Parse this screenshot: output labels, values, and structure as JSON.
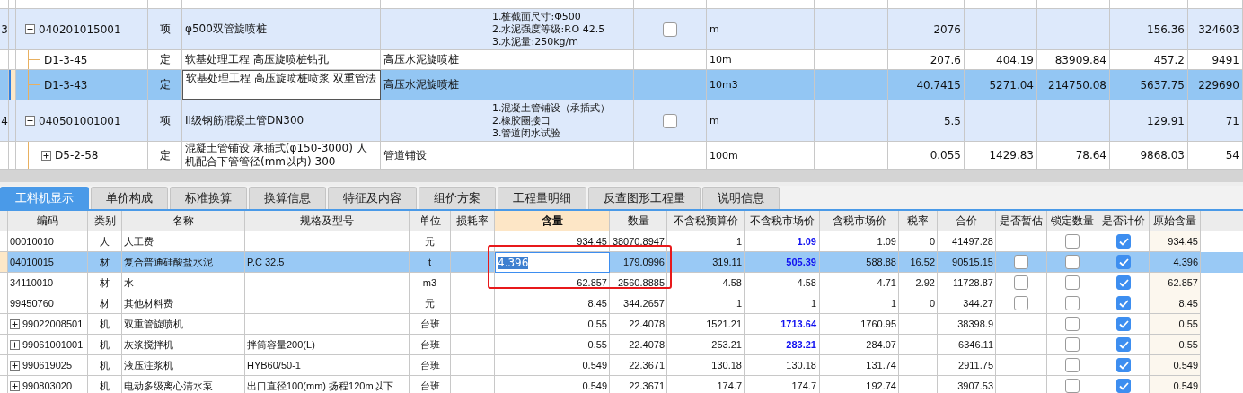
{
  "upper_grid": {
    "rows": [
      {
        "number": "3",
        "code": "040201015001",
        "type": "项",
        "kind": "item",
        "selected": false,
        "expanded": true,
        "name": "φ500双管旋喷桩",
        "features": [
          "1.桩截面尺寸:Φ500",
          "2.水泥强度等级:P.O 42.5",
          "3.水泥量:250kg/m"
        ],
        "checked": false,
        "unit": "m",
        "column_10": "2076",
        "column_13": "156.36",
        "column_14": "324603",
        "children": [
          {
            "code": "D1-3-45",
            "type": "定",
            "kind": "quota",
            "selected": false,
            "name": "软基处理工程 高压旋喷桩钻孔",
            "column_6": "高压水泥旋喷桩",
            "unit": "10m",
            "column_10": "207.6",
            "column_11": "404.19",
            "column_12": "83909.84",
            "column_13": "457.2",
            "column_14": "9491"
          },
          {
            "code": "D1-3-43",
            "type": "定",
            "kind": "quota",
            "selected": true,
            "name": "软基处理工程 高压旋喷桩喷浆 双重管法",
            "column_6": "高压水泥旋喷桩",
            "unit": "10m3",
            "column_10": "40.7415",
            "column_11": "5271.04",
            "column_12": "214750.08",
            "column_13": "5637.75",
            "column_14": "229690"
          }
        ]
      },
      {
        "number": "4",
        "code": "040501001001",
        "type": "项",
        "kind": "item",
        "selected": false,
        "expanded": true,
        "name": "II级钢筋混凝土管DN300",
        "features": [
          "1.混凝土管铺设（承插式）",
          "2.橡胶圈接口",
          "3.管道闭水试验"
        ],
        "checked": false,
        "unit": "m",
        "column_10": "5.5",
        "column_13": "129.91",
        "column_14": "71",
        "children": [
          {
            "code": "D5-2-58",
            "type": "定",
            "kind": "quota",
            "selected": false,
            "expanded": false,
            "name": "混凝土管铺设 承插式(φ150-3000) 人机配合下管管径(mm以内) 300",
            "column_6": "管道铺设",
            "unit": "100m",
            "column_10": "0.055",
            "column_11": "1429.83",
            "column_12": "78.64",
            "column_13": "9868.03",
            "column_14": "54"
          }
        ]
      }
    ]
  },
  "tabs": [
    {
      "label": "工料机显示",
      "selected": true
    },
    {
      "label": "单价构成",
      "selected": false
    },
    {
      "label": "标准换算",
      "selected": false
    },
    {
      "label": "换算信息",
      "selected": false
    },
    {
      "label": "特征及内容",
      "selected": false
    },
    {
      "label": "组价方案",
      "selected": false
    },
    {
      "label": "工程量明细",
      "selected": false
    },
    {
      "label": "反查图形工程量",
      "selected": false
    },
    {
      "label": "说明信息",
      "selected": false
    }
  ],
  "resource_table": {
    "columns": [
      {
        "label": "编码",
        "selected": false
      },
      {
        "label": "类别",
        "selected": false
      },
      {
        "label": "名称",
        "selected": false
      },
      {
        "label": "规格及型号",
        "selected": false
      },
      {
        "label": "单位",
        "selected": false
      },
      {
        "label": "损耗率",
        "selected": false
      },
      {
        "label": "含量",
        "selected": true
      },
      {
        "label": "数量",
        "selected": false
      },
      {
        "label": "不含税预算价",
        "selected": false
      },
      {
        "label": "不含税市场价",
        "selected": false
      },
      {
        "label": "含税市场价",
        "selected": false
      },
      {
        "label": "税率",
        "selected": false
      },
      {
        "label": "合价",
        "selected": false
      },
      {
        "label": "是否暂估",
        "selected": false
      },
      {
        "label": "锁定数量",
        "selected": false
      },
      {
        "label": "是否计价",
        "selected": false
      },
      {
        "label": "原始含量",
        "selected": false
      }
    ],
    "rows": [
      {
        "selected": false,
        "code": "00010010",
        "type": "人",
        "name": "人工费",
        "unit": "元",
        "content": "934.45",
        "quantity": "38070.8947",
        "budget_price": "1",
        "market_price": "1.09",
        "market_price_highlighted": true,
        "tax_market_price": "1.09",
        "tax_rate": "0",
        "total": "41497.28",
        "locked": false,
        "priced": true,
        "original_content": "934.45"
      },
      {
        "selected": true,
        "code": "04010015",
        "type": "材",
        "name": "复合普通硅酸盐水泥",
        "spec": "P.C 32.5",
        "unit": "t",
        "content": "4.396",
        "quantity": "179.0996",
        "budget_price": "319.11",
        "market_price": "505.39",
        "market_price_highlighted": true,
        "tax_market_price": "588.88",
        "tax_rate": "16.52",
        "total": "90515.15",
        "provisional": false,
        "locked": false,
        "priced": true,
        "original_content": "4.396"
      },
      {
        "selected": false,
        "code": "34110010",
        "type": "材",
        "name": "水",
        "unit": "m3",
        "content": "62.857",
        "quantity": "2560.8885",
        "budget_price": "4.58",
        "market_price": "4.58",
        "market_price_highlighted": false,
        "tax_market_price": "4.71",
        "tax_rate": "2.92",
        "total": "11728.87",
        "provisional": false,
        "locked": false,
        "priced": true,
        "original_content": "62.857"
      },
      {
        "selected": false,
        "code": "99450760",
        "type": "材",
        "name": "其他材料费",
        "unit": "元",
        "content": "8.45",
        "quantity": "344.2657",
        "budget_price": "1",
        "market_price": "1",
        "market_price_highlighted": false,
        "tax_market_price": "1",
        "tax_rate": "0",
        "total": "344.27",
        "provisional": false,
        "locked": false,
        "priced": true,
        "original_content": "8.45"
      },
      {
        "selected": false,
        "expanded": false,
        "code": "99022008501",
        "type": "机",
        "name": "双重管旋喷机",
        "unit": "台班",
        "content": "0.55",
        "quantity": "22.4078",
        "budget_price": "1521.21",
        "market_price": "1713.64",
        "market_price_highlighted": true,
        "tax_market_price": "1760.95",
        "total": "38398.9",
        "locked": false,
        "priced": true,
        "original_content": "0.55"
      },
      {
        "selected": false,
        "expanded": false,
        "code": "99061001001",
        "type": "机",
        "name": "灰浆搅拌机",
        "spec": "拌筒容量200(L)",
        "unit": "台班",
        "content": "0.55",
        "quantity": "22.4078",
        "budget_price": "253.21",
        "market_price": "283.21",
        "market_price_highlighted": true,
        "tax_market_price": "284.07",
        "total": "6346.11",
        "locked": false,
        "priced": true,
        "original_content": "0.55"
      },
      {
        "selected": false,
        "expanded": false,
        "code": "990619025",
        "type": "机",
        "name": "液压注浆机",
        "spec": "HYB60/50-1",
        "unit": "台班",
        "content": "0.549",
        "quantity": "22.3671",
        "budget_price": "130.18",
        "market_price": "130.18",
        "market_price_highlighted": false,
        "tax_market_price": "131.74",
        "total": "2911.75",
        "locked": false,
        "priced": true,
        "original_content": "0.549"
      },
      {
        "selected": false,
        "expanded": false,
        "code": "990803020",
        "type": "机",
        "name": "电动多级离心清水泵",
        "spec": "出口直径100(mm) 扬程120m以下",
        "unit": "台班",
        "content": "0.549",
        "quantity": "22.3671",
        "budget_price": "174.7",
        "market_price": "174.7",
        "market_price_highlighted": false,
        "tax_market_price": "192.74",
        "total": "3907.53",
        "locked": false,
        "priced": true,
        "original_content": "0.549"
      }
    ]
  }
}
